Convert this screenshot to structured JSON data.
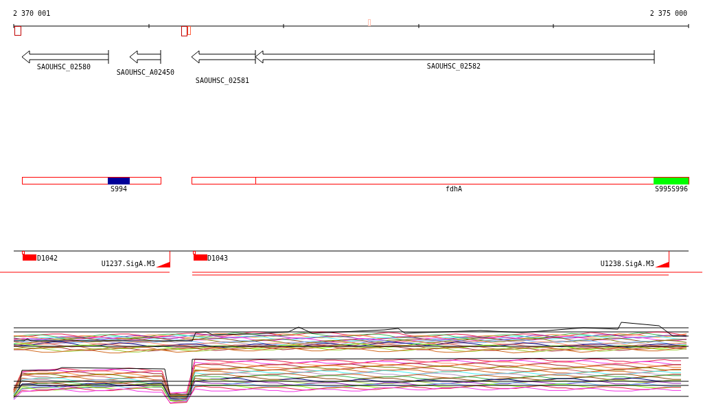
{
  "ruler": {
    "start_label": "2 370 001",
    "end_label": "2 375 000"
  },
  "genes": [
    {
      "name": "SAOUHSC_02580"
    },
    {
      "name": "SAOUHSC_A02450"
    },
    {
      "name": "SAOUHSC_02581"
    },
    {
      "name": "SAOUHSC_02582"
    }
  ],
  "segments": [
    {
      "label": "S994",
      "color": "#000099"
    },
    {
      "label": "fdhA"
    },
    {
      "label": "S995S996",
      "color": "#00ff00"
    }
  ],
  "promoters": [
    {
      "label": "D1042",
      "kind": "box"
    },
    {
      "label": "U1237.SigA.M3",
      "kind": "ramp"
    },
    {
      "label": "D1043",
      "kind": "box"
    },
    {
      "label": "U1238.SigA.M3",
      "kind": "ramp"
    }
  ]
}
